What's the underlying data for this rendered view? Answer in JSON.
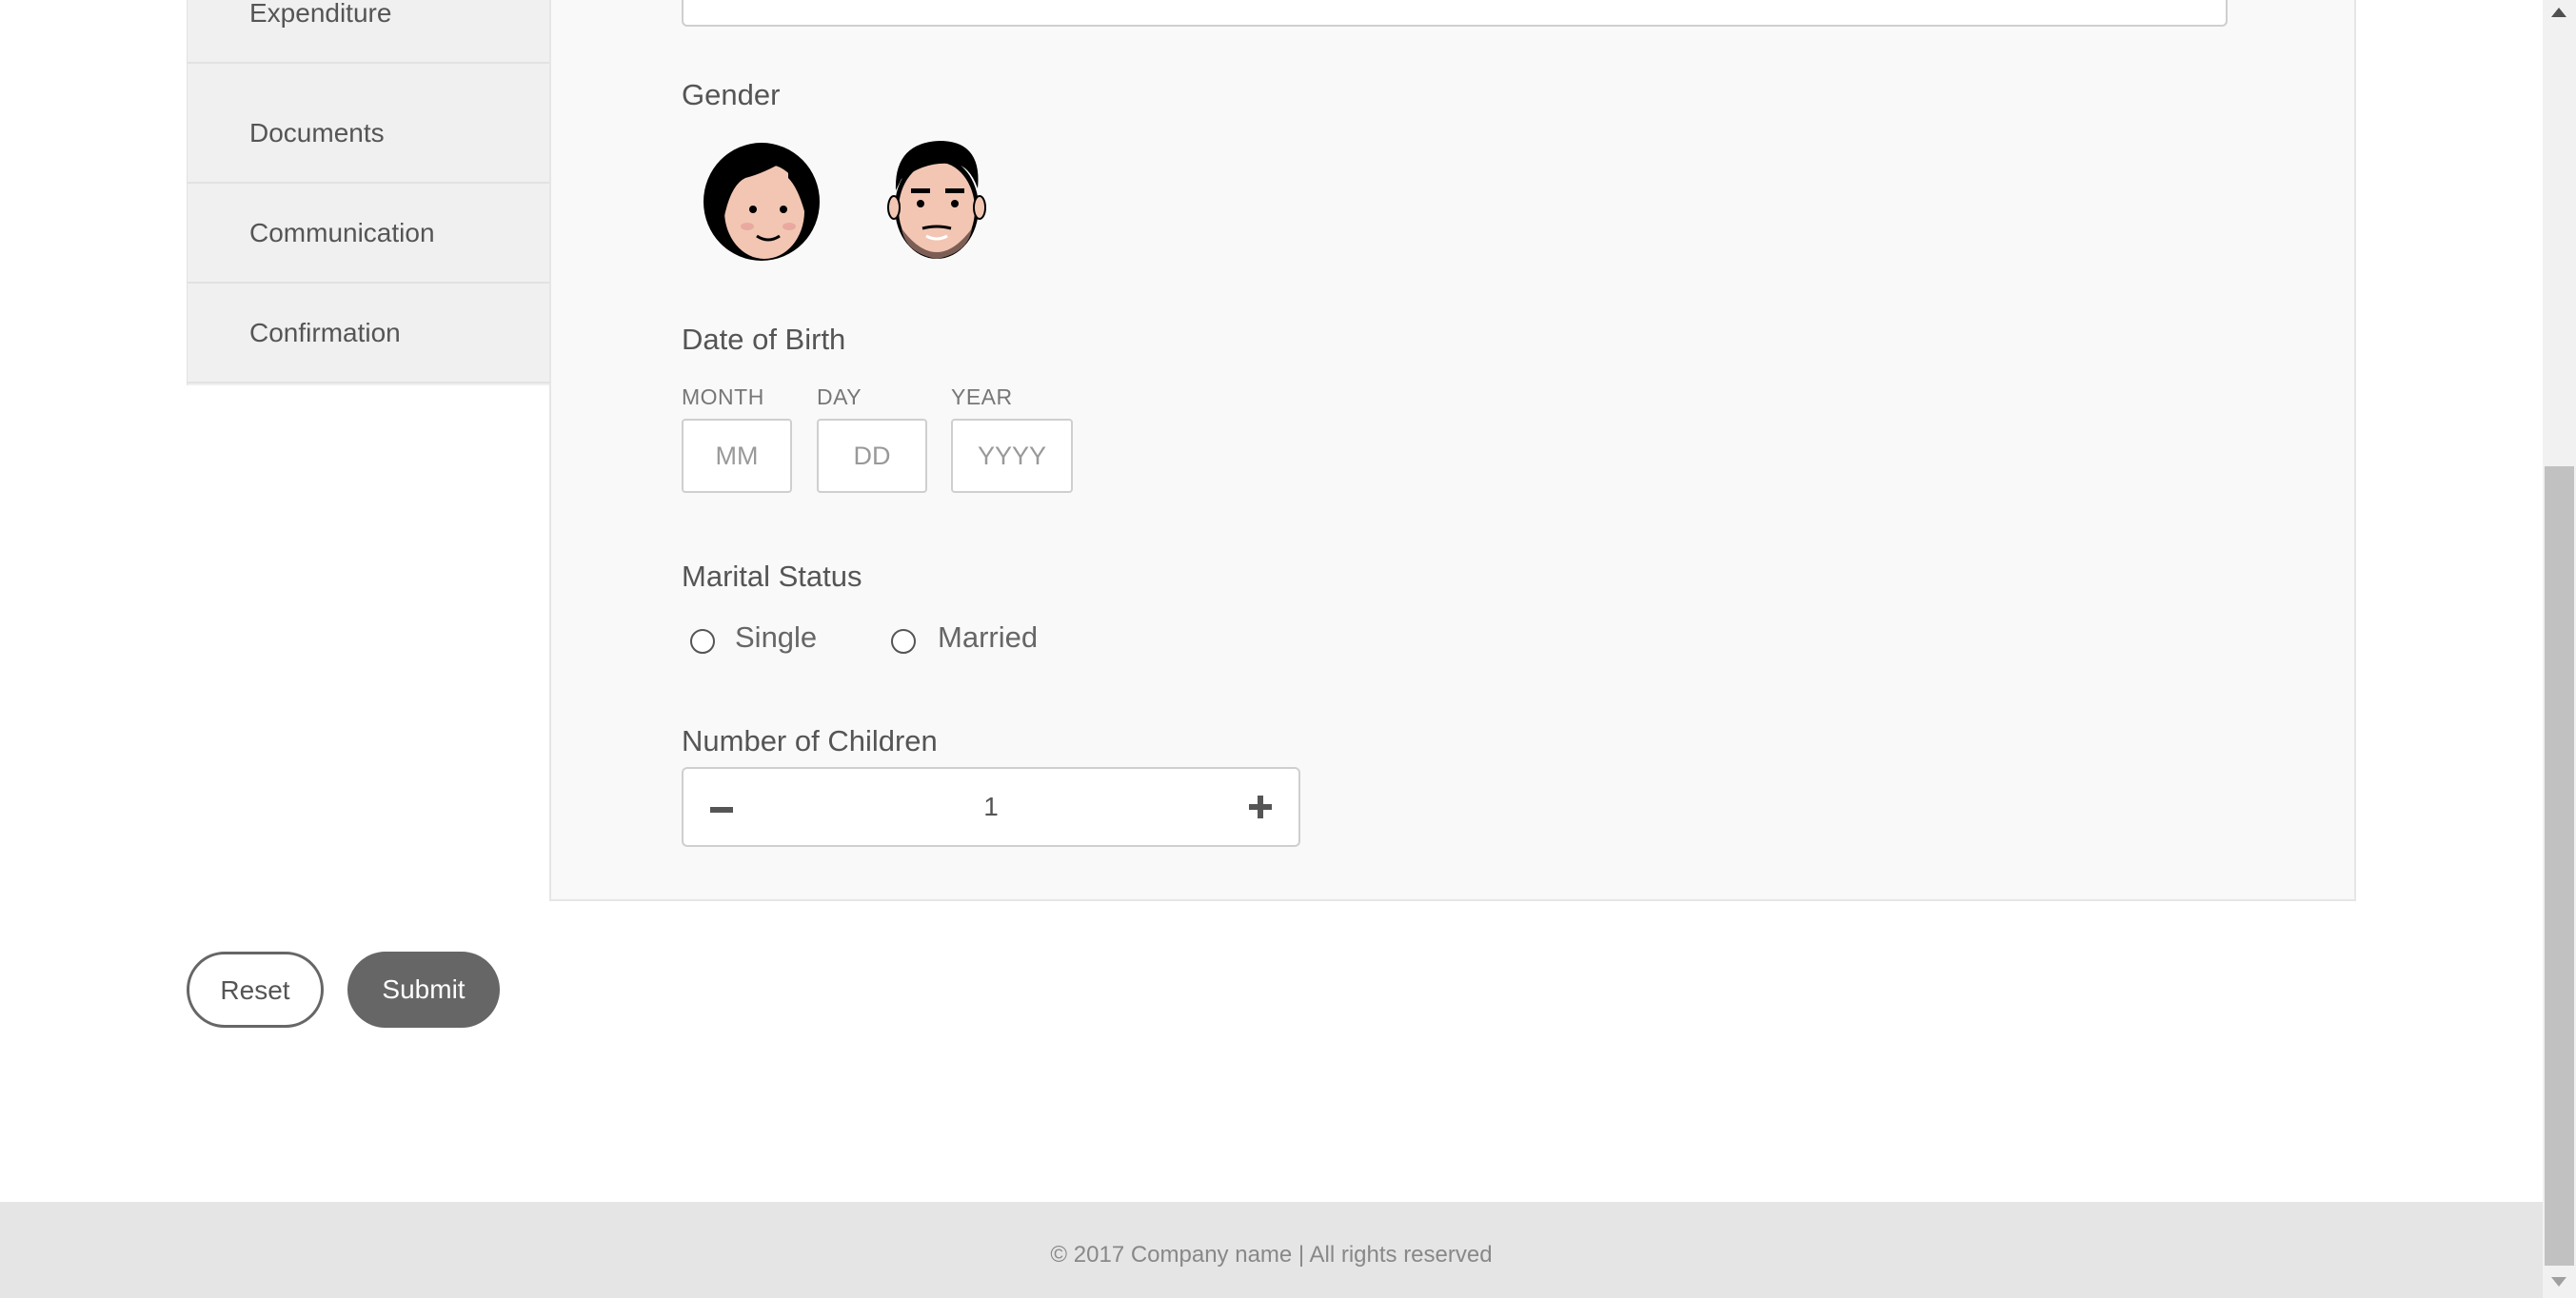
{
  "sidebar": {
    "items": [
      {
        "label": "Expenditure"
      },
      {
        "label": "Documents"
      },
      {
        "label": "Communication"
      },
      {
        "label": "Confirmation"
      }
    ]
  },
  "form": {
    "gender": {
      "label": "Gender",
      "options": [
        {
          "icon": "female-avatar-icon"
        },
        {
          "icon": "male-avatar-icon"
        }
      ]
    },
    "dob": {
      "label": "Date of Birth",
      "month": {
        "label": "MONTH",
        "placeholder": "MM"
      },
      "day": {
        "label": "DAY",
        "placeholder": "DD"
      },
      "year": {
        "label": "YEAR",
        "placeholder": "YYYY"
      }
    },
    "marital_status": {
      "label": "Marital Status",
      "options": [
        {
          "label": "Single",
          "selected": false
        },
        {
          "label": "Married",
          "selected": false
        }
      ]
    },
    "children": {
      "label": "Number of Children",
      "value": "1",
      "decrement_icon": "minus-icon",
      "increment_icon": "plus-icon"
    }
  },
  "actions": {
    "reset_label": "Reset",
    "submit_label": "Submit"
  },
  "footer": {
    "text": "© 2017 Company name | All rights reserved"
  },
  "colors": {
    "sidebar_bg": "#f0f0f0",
    "panel_bg": "#f9f9f9",
    "button_dark": "#666666",
    "footer_bg": "#e5e5e5"
  }
}
